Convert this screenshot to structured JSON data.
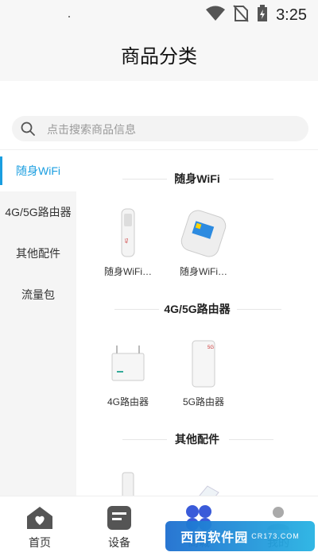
{
  "status_bar": {
    "time": "3:25",
    "icons": [
      "wifi-icon",
      "no-sim-icon",
      "battery-charging-icon"
    ]
  },
  "header": {
    "title": "商品分类"
  },
  "search": {
    "placeholder": "点击搜索商品信息",
    "value": ""
  },
  "sidebar": {
    "items": [
      {
        "label": "随身WiFi",
        "active": true
      },
      {
        "label": "4G/5G路由器",
        "active": false
      },
      {
        "label": "其他配件",
        "active": false
      },
      {
        "label": "流量包",
        "active": false
      }
    ]
  },
  "sections": [
    {
      "title": "随身WiFi",
      "products": [
        {
          "name": "随身WiFi…"
        },
        {
          "name": "随身WiFi…"
        }
      ]
    },
    {
      "title": "4G/5G路由器",
      "products": [
        {
          "name": "4G路由器"
        },
        {
          "name": "5G路由器"
        }
      ]
    },
    {
      "title": "其他配件",
      "products": [
        {
          "name": ""
        },
        {
          "name": ""
        }
      ]
    }
  ],
  "bottom_nav": {
    "items": [
      {
        "label": "首页",
        "icon": "home-icon"
      },
      {
        "label": "设备",
        "icon": "device-icon"
      },
      {
        "label": "商城",
        "icon": "mall-icon",
        "active": true
      },
      {
        "label": "我的",
        "icon": "profile-icon"
      }
    ]
  },
  "watermark": {
    "text": "西西软件园",
    "sub": "CR173.COM"
  },
  "colors": {
    "accent": "#1a9ee0",
    "sidebar_bg": "#f5f5f5",
    "header_bg": "#f7f7f7",
    "active_nav": "#3a5bd9"
  }
}
